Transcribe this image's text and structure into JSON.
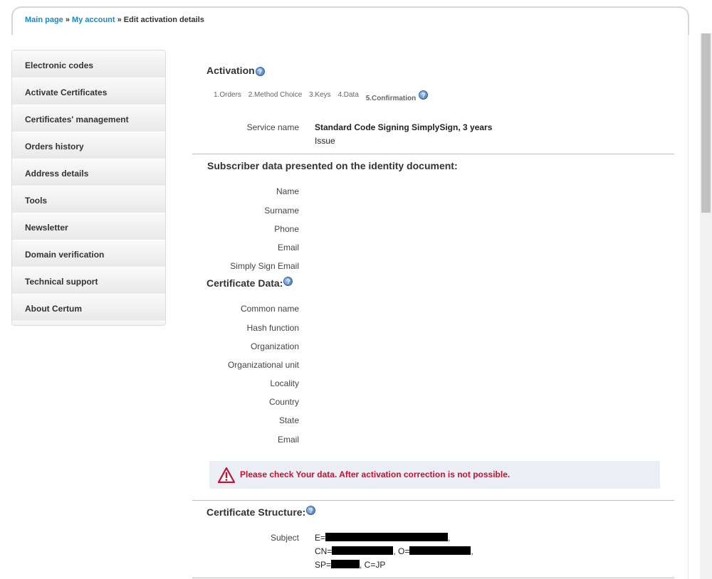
{
  "breadcrumb": {
    "main_page": "Main page",
    "sep1": " » ",
    "my_account": "My account",
    "sep2": " » ",
    "current": "Edit activation details"
  },
  "sidebar": {
    "items": [
      {
        "label": "Electronic codes"
      },
      {
        "label": "Activate Certificates"
      },
      {
        "label": "Certificates' management"
      },
      {
        "label": "Orders history"
      },
      {
        "label": "Address details"
      },
      {
        "label": "Tools"
      },
      {
        "label": "Newsletter"
      },
      {
        "label": "Domain verification"
      },
      {
        "label": "Technical support"
      },
      {
        "label": "About Certum"
      }
    ]
  },
  "activation": {
    "title": "Activation",
    "help_icon": "help-icon",
    "steps": [
      "1.Orders",
      "2.Method Choice",
      "3.Keys",
      "4.Data",
      "5.Confirmation"
    ],
    "service_label": "Service name",
    "service_value": "Standard Code Signing SimplySign, 3 years",
    "service_type": "Issue"
  },
  "subscriber": {
    "title": "Subscriber data presented on the identity document:",
    "fields": [
      "Name",
      "Surname",
      "Phone",
      "Email",
      "Simply Sign Email"
    ]
  },
  "certificate": {
    "title": "Certificate Data:",
    "fields": [
      "Common name",
      "Hash function",
      "Organization",
      "Organizational unit",
      "Locality",
      "Country",
      "State",
      "Email"
    ]
  },
  "warning": {
    "icon": "warning-triangle-icon",
    "text": "Please check Your data. After activation correction is not possible."
  },
  "structure": {
    "title": "Certificate Structure:",
    "subject_label": "Subject",
    "line1_prefix": "E=",
    "line1_suffix": ",",
    "line2_a": "CN=",
    "line2_b": ", O=",
    "line2_c": ",",
    "line3_a": "SP=",
    "line3_b": ", C=JP"
  },
  "colors": {
    "link": "#1a87c9",
    "warning_text": "#c8102e",
    "warning_bg": "#ebeef5"
  }
}
